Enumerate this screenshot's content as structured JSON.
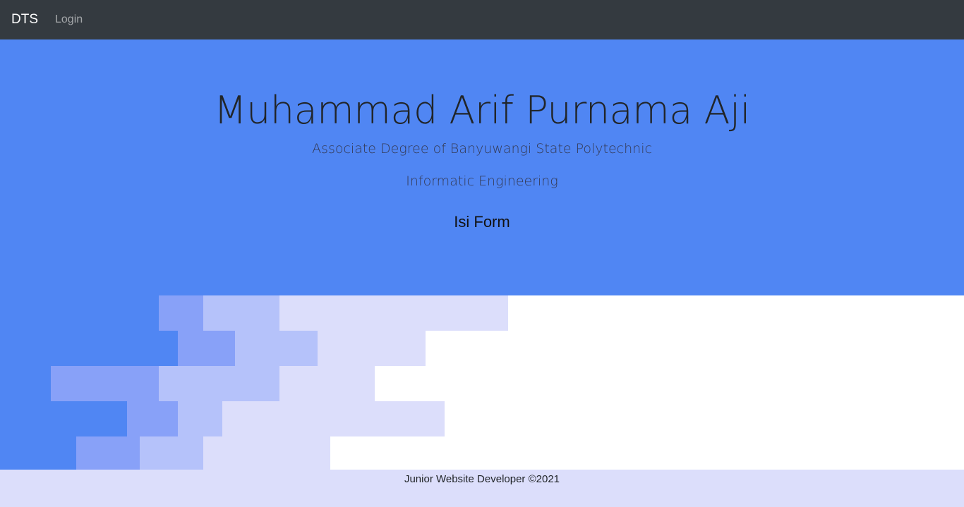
{
  "navbar": {
    "brand": "DTS",
    "links": [
      {
        "label": "Login"
      }
    ]
  },
  "hero": {
    "title": "Muhammad Arif Purnama Aji",
    "subtitle": "Associate Degree of Banyuwangi State Polytechnic",
    "department": "Informatic Engineering",
    "cta_label": "Isi Form"
  },
  "footer": {
    "text": "Junior Website Developer ©2021"
  },
  "colors": {
    "navbar": "#343a40",
    "hero": "#5086f3",
    "wave_1": "#88a1f8",
    "wave_2": "#b5c2fa",
    "wave_3": "#dcdefb",
    "footer": "#dcdefb"
  }
}
